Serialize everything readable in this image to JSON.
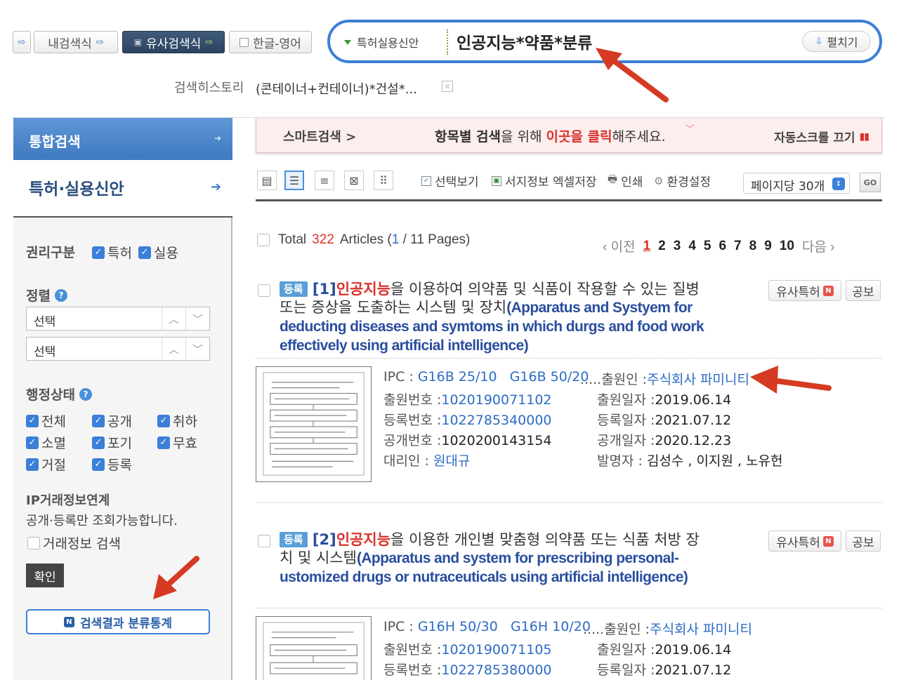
{
  "toolbar": {
    "prev_icon": "arrow-out-icon",
    "my_search": "내검색식",
    "similar_search": "유사검색식",
    "hangul_english": "한글-영어"
  },
  "search": {
    "scope": "특허실용신안",
    "query": "인공지능*약품*분류",
    "expand": "펼치기"
  },
  "history": {
    "label": "검색히스토리",
    "item": "(콘테이너+컨테이너)*건설*..."
  },
  "sidebar": {
    "integrated": "통합검색",
    "patent": "특허·실용신안",
    "rights_label": "권리구분",
    "rights": [
      "특허",
      "실용"
    ],
    "sort_label": "정렬",
    "sort1": "선택",
    "sort2": "선택",
    "status_label": "행정상태",
    "statuses": [
      "전체",
      "공개",
      "취하",
      "소멸",
      "포기",
      "무효",
      "거절",
      "등록"
    ],
    "ip_label": "IP거래정보연계",
    "ip_note": "공개·등록만 조회가능합니다.",
    "trade_search": "거래정보 검색",
    "ok": "확인",
    "stats": "검색결과 분류통계"
  },
  "banner": {
    "smart": "스마트검색 >",
    "msg_pre": "항목별 검색",
    "msg_mid": "을 위해 ",
    "msg_click": "이곳을 클릭",
    "msg_post": "해주세요.",
    "auto_scroll": "자동스크롤 끄기"
  },
  "viewbar": {
    "select_view": "선택보기",
    "excel": "서지정보 엑셀저장",
    "print": "인쇄",
    "settings": "환경설정",
    "per_page": "페이지당 30개",
    "go": "GO"
  },
  "results_header": {
    "total_label": "Total",
    "total": "322",
    "articles": "Articles (",
    "page": "1",
    "pages": "/ 11 Pages)",
    "prev": "이전",
    "next": "다음",
    "page_numbers": [
      "1",
      "2",
      "3",
      "4",
      "5",
      "6",
      "7",
      "8",
      "9",
      "10"
    ]
  },
  "results": [
    {
      "badge": "등록",
      "num": "[1]",
      "t1": "인공지능",
      "t2": "을 이용하여 의",
      "t3": "약품",
      "t4": " 및 식품이 작용할 수 있는 질병 또는 증상을 도출하는 시스템 및 장치",
      "en": "(Apparatus and Systyem for deducting diseases and symtoms in which durgs and food work effectively using artificial intelligence)",
      "similar": "유사특허",
      "gazette": "공보",
      "ipc_label": "IPC :",
      "ipc1": "G16B 25/10",
      "ipc2": "G16B 50/20",
      "dots": ".....",
      "applicant_label": "출원인 :",
      "applicant": "주식회사 파미니티",
      "appno_label": "출원번호 :",
      "appno": "1020190071102",
      "appdate_label": "출원일자 :",
      "appdate": "2019.06.14",
      "regno_label": "등록번호 :",
      "regno": "1022785340000",
      "regdate_label": "등록일자 :",
      "regdate": "2021.07.12",
      "pubno_label": "공개번호 :",
      "pubno": "1020200143154",
      "pubdate_label": "공개일자 :",
      "pubdate": "2020.12.23",
      "agent_label": "대리인 :",
      "agent": "원대규",
      "inventor_label": "발명자 :",
      "inventors": "김성수 , 이지원 , 노유헌"
    },
    {
      "badge": "등록",
      "num": "[2]",
      "t1": "인공지능",
      "t2": "을 이용한 개인별 맞춤형 의",
      "t3": "약품",
      "t4": " 또는 식품 처방 장치 및 시스템",
      "en": "(Apparatus and system for prescribing personal-ustomized drugs or nutraceuticals using artificial intelligence)",
      "similar": "유사특허",
      "gazette": "공보",
      "ipc_label": "IPC :",
      "ipc1": "G16H 50/30",
      "ipc2": "G16H 10/20",
      "dots": ".....",
      "applicant_label": "출원인 :",
      "applicant": "주식회사 파미니티",
      "appno_label": "출원번호 :",
      "appno": "1020190071105",
      "appdate_label": "출원일자 :",
      "appdate": "2019.06.14",
      "regno_label": "등록번호 :",
      "regno": "1022785380000",
      "regdate_label": "등록일자 :",
      "regdate": "2021.07.12"
    }
  ],
  "colors": {
    "accent": "#3b7fd8",
    "highlight_red": "#d9312b",
    "title_blue": "#2a4e9e",
    "annotation_arrow": "#d63a22"
  }
}
